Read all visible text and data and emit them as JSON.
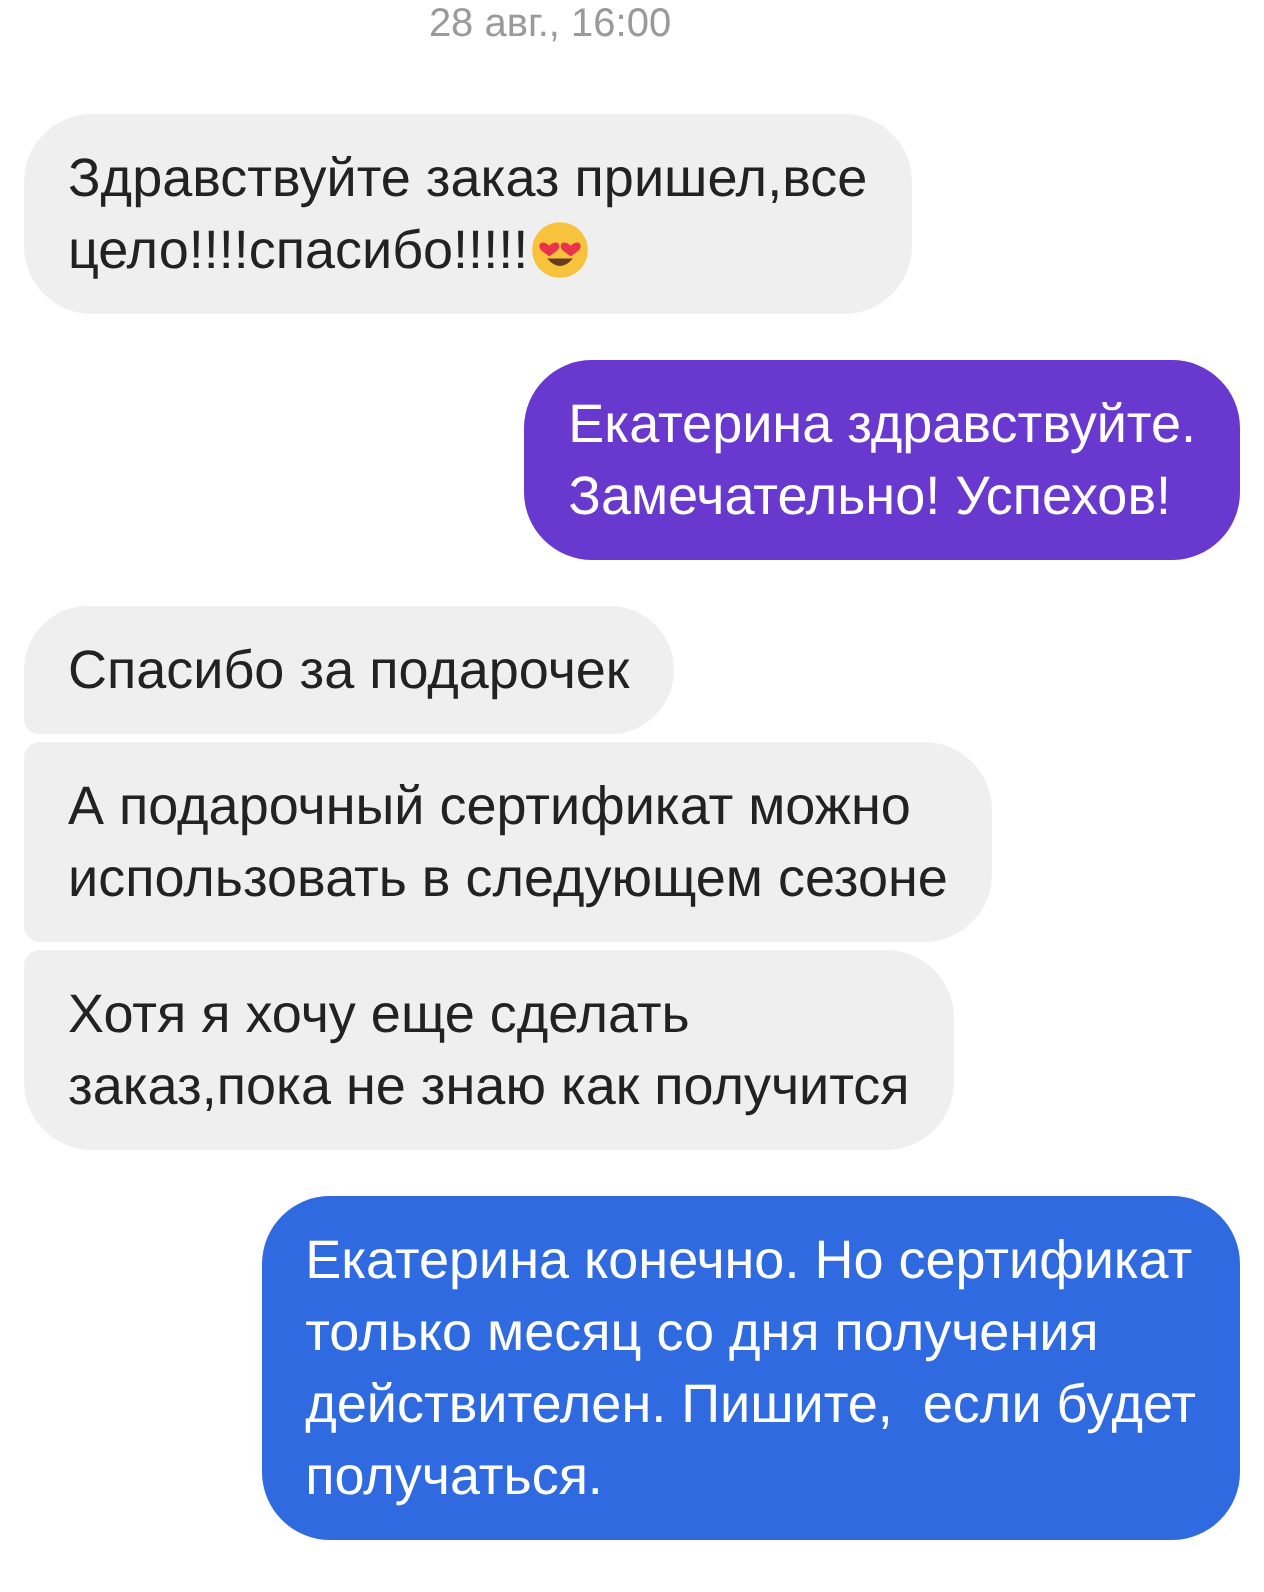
{
  "timestamp": "28 авг., 16:00",
  "messages": [
    {
      "kind": "incoming",
      "color": "#efefef",
      "lines": [
        "Здравствуйте заказ пришел,все",
        "цело!!!!спасибо!!!!!"
      ],
      "emoji": {
        "kind": "heart-eyes"
      }
    },
    {
      "kind": "outgoing",
      "color": "#6838cf",
      "lines": [
        "Екатерина здравствуйте.",
        "Замечательно! Успехов!"
      ]
    },
    {
      "kind": "incoming",
      "color": "#efefef",
      "lines": [
        "Спасибо за подарочек"
      ]
    },
    {
      "kind": "incoming",
      "color": "#efefef",
      "lines": [
        "А подарочный сертификат можно",
        "использовать в следующем сезоне"
      ]
    },
    {
      "kind": "incoming",
      "color": "#efefef",
      "lines": [
        "Хотя я хочу еще сделать",
        "заказ,пока не знаю как получится"
      ]
    },
    {
      "kind": "outgoing",
      "color": "#2f6ae0",
      "lines": [
        "Екатерина конечно. Но сертификат",
        "только месяц со дня получения",
        "действителен. Пишите,  если будет",
        "получаться."
      ]
    }
  ]
}
